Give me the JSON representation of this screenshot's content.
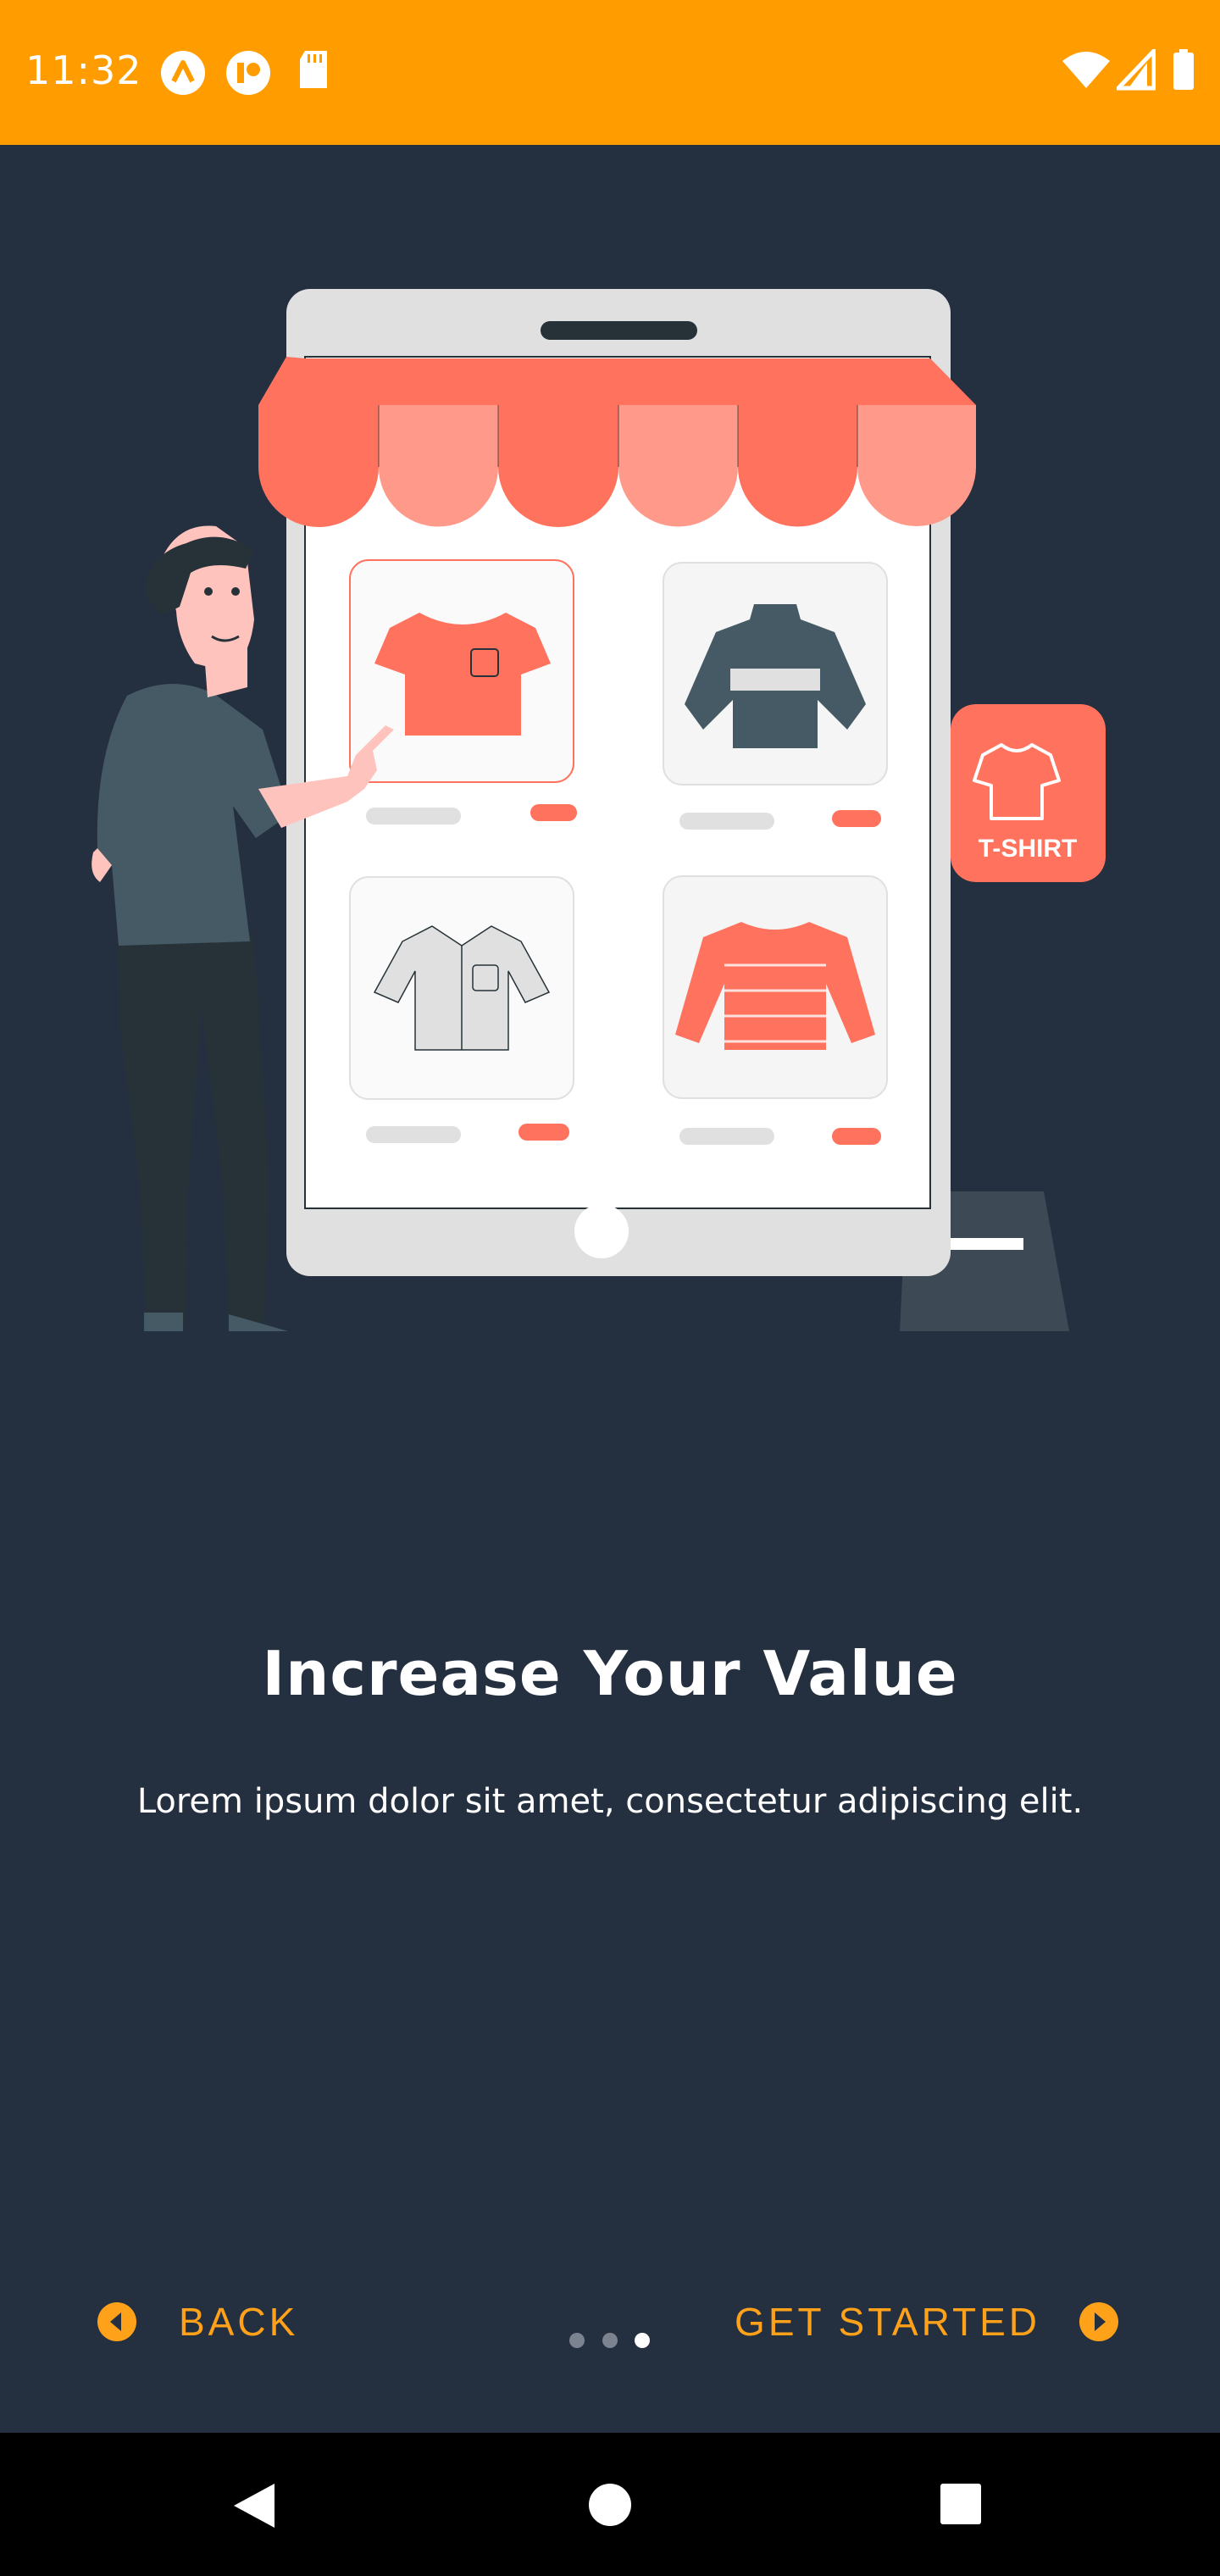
{
  "status_bar": {
    "time": "11:32",
    "left_icons": [
      "app-a-icon",
      "app-b-icon",
      "sd-card-icon"
    ],
    "right_icons": [
      "wifi-icon",
      "cell-signal-icon",
      "battery-icon"
    ],
    "color": "#ff9c00"
  },
  "illustration": {
    "badge_label": "T-SHIRT"
  },
  "onboarding": {
    "title": "Increase Your Value",
    "subtitle": "Lorem ipsum dolor sit amet, consectetur adipiscing elit.",
    "page_count": 3,
    "current_page": 3
  },
  "nav_buttons": {
    "back_label": "BACK",
    "get_started_label": "GET STARTED",
    "accent": "#ffa21a"
  },
  "system_nav": {
    "icons": [
      "back-triangle-icon",
      "home-circle-icon",
      "recents-square-icon"
    ]
  },
  "colors": {
    "background": "#242f40",
    "awning_dark": "#ff725e",
    "awning_light": "#ff9a8b"
  }
}
